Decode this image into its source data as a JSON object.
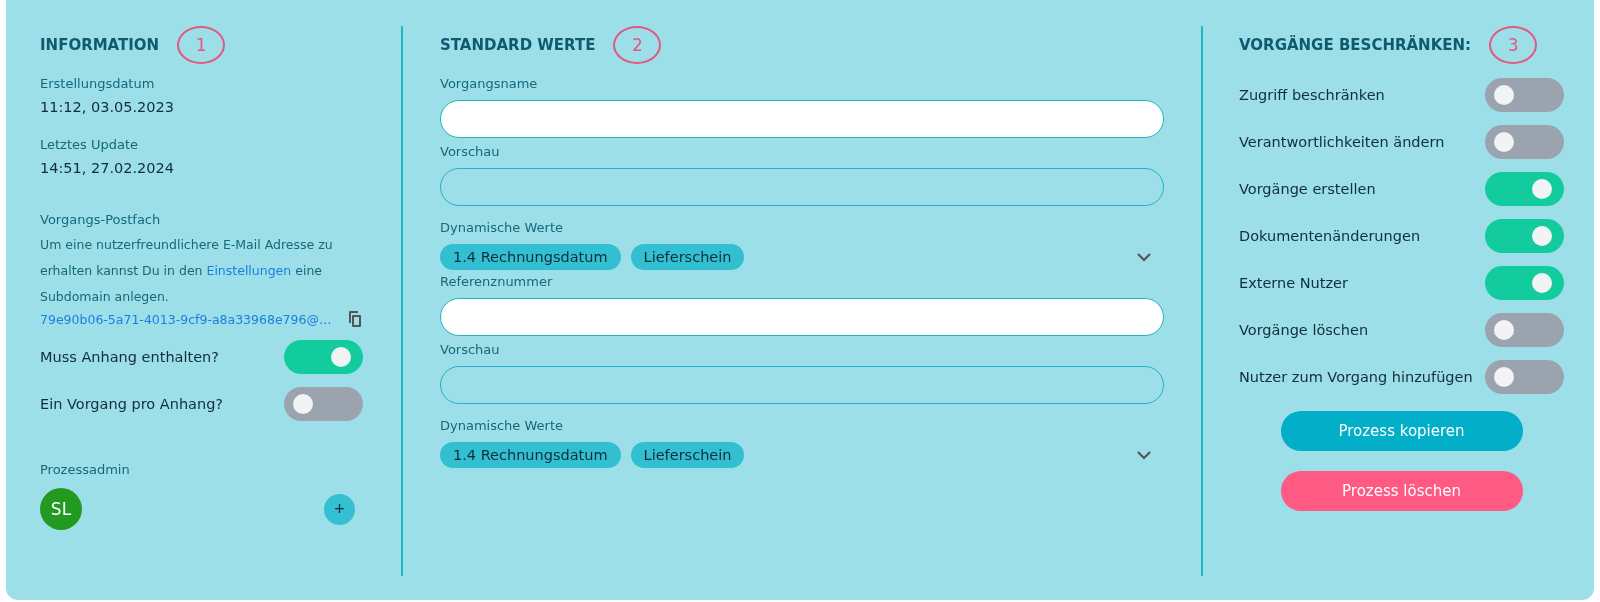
{
  "information": {
    "title": "INFORMATION",
    "marker": "1",
    "fields": [
      {
        "label": "Erstellungsdatum",
        "value": "11:12, 03.05.2023"
      },
      {
        "label": "Letztes Update",
        "value": "14:51, 27.02.2024"
      }
    ],
    "mailbox": {
      "label": "Vorgangs-Postfach",
      "text_before": "Um eine nutzerfreundlichere E-Mail Adresse zu erhalten kannst Du in den",
      "link": "Einstellungen",
      "text_after": "eine Subdomain anlegen.",
      "address": "79e90b06-5a71-4013-9cf9-a8a33968e796@…"
    },
    "toggles": [
      {
        "label": "Muss Anhang enthalten?",
        "on": true
      },
      {
        "label": "Ein Vorgang pro Anhang?",
        "on": false
      }
    ],
    "admin": {
      "label": "Prozessadmin",
      "initials": "SL",
      "add": "+"
    }
  },
  "standard_values": {
    "title": "STANDARD WERTE",
    "marker": "2",
    "groups": [
      {
        "field_label": "Vorgangsname",
        "preview_label": "Vorschau",
        "dynamic_label": "Dynamische Werte",
        "tags": [
          "1.4 Rechnungsdatum",
          "Lieferschein"
        ]
      },
      {
        "field_label": "Referenznummer",
        "preview_label": "Vorschau",
        "dynamic_label": "Dynamische Werte",
        "tags": [
          "1.4 Rechnungsdatum",
          "Lieferschein"
        ]
      }
    ]
  },
  "restrictions": {
    "title": "VORGÄNGE BESCHRÄNKEN:",
    "marker": "3",
    "toggles": [
      {
        "label": "Zugriff beschränken",
        "on": false
      },
      {
        "label": "Verantwortlichkeiten ändern",
        "on": false
      },
      {
        "label": "Vorgänge erstellen",
        "on": true
      },
      {
        "label": "Dokumentenänderungen",
        "on": true
      },
      {
        "label": "Externe Nutzer",
        "on": true
      },
      {
        "label": "Vorgänge löschen",
        "on": false
      },
      {
        "label": "Nutzer zum Vorgang hinzufügen",
        "on": false
      }
    ],
    "buttons": [
      {
        "label": "Prozess kopieren",
        "kind": "primary"
      },
      {
        "label": "Prozess löschen",
        "kind": "danger"
      }
    ]
  }
}
